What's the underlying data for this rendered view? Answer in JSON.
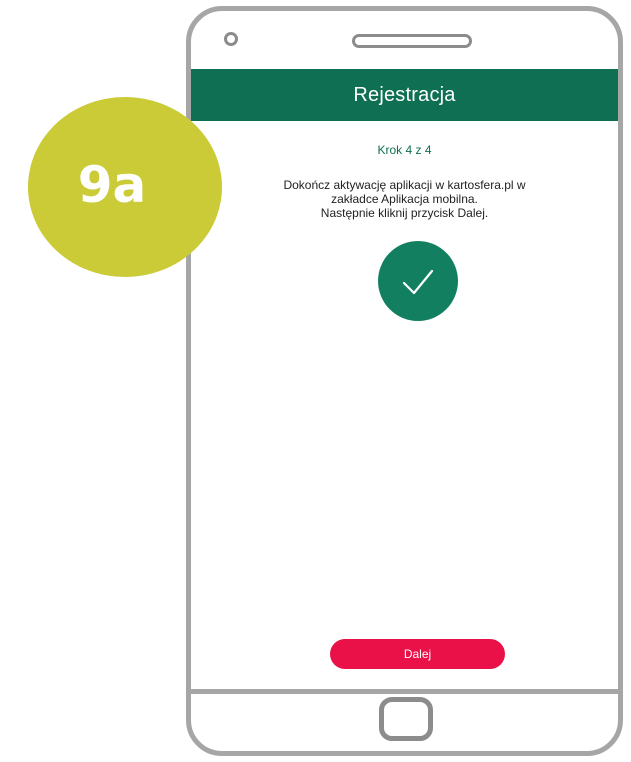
{
  "badge": {
    "label": "9a"
  },
  "app": {
    "header_title": "Rejestracja",
    "step_label": "Krok 4 z 4",
    "instructions": [
      "Dokończ aktywację aplikacji w kartosfera.pl w",
      "zakładce Aplikacja mobilna.",
      "Następnie kliknij przycisk Dalej."
    ],
    "next_button_label": "Dalej"
  },
  "colors": {
    "header": "#0e6f52",
    "accent_green": "#128060",
    "button": "#ea1148",
    "badge": "#cacb37",
    "frame": "#a6a6a6"
  },
  "icons": {
    "success": "checkmark-icon"
  }
}
